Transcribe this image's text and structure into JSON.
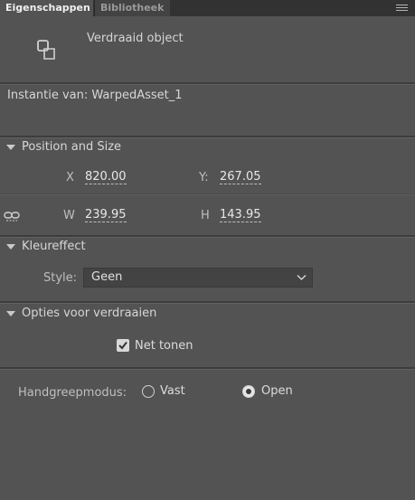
{
  "tabs": [
    {
      "label": "Eigenschappen",
      "active": true
    },
    {
      "label": "Bibliotheek",
      "active": false
    }
  ],
  "panel_menu_icon": "hamburger-menu-icon",
  "object": {
    "icon": "warped-object-icon",
    "title": "Verdraaid object",
    "instance_text": "Instantie van:  WarpedAsset_1"
  },
  "position_size": {
    "heading": "Position and Size",
    "x_label": "X",
    "x_value": "820.00",
    "y_label": "Y:",
    "y_value": "267.05",
    "w_label": "W",
    "w_value": "239.95",
    "h_label": "H",
    "h_value": "143.95",
    "link_icon": "chain-link-icon"
  },
  "color_effect": {
    "heading": "Kleureffect",
    "style_label": "Style:",
    "style_value": "Geen"
  },
  "warp_options": {
    "heading": "Opties voor verdraaien",
    "show_net_label": "Net tonen",
    "show_net_checked": true,
    "handle_mode_label": "Handgreepmodus:",
    "options": [
      {
        "label": "Vast",
        "selected": false
      },
      {
        "label": "Open",
        "selected": true
      }
    ]
  }
}
